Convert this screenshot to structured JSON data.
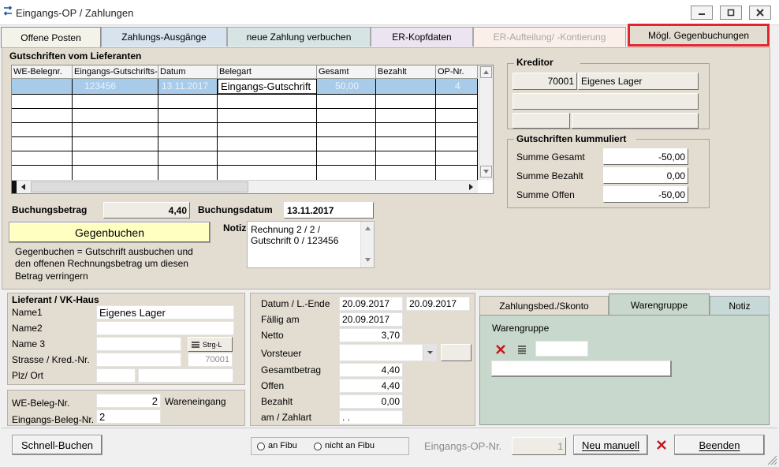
{
  "window": {
    "title": "Eingangs-OP / Zahlungen"
  },
  "tabs": [
    {
      "label": "Offene Posten"
    },
    {
      "label": "Zahlungs-Ausgänge"
    },
    {
      "label": "neue Zahlung verbuchen"
    },
    {
      "label": "ER-Kopfdaten"
    },
    {
      "label": "ER-Aufteilung/ -Kontierung"
    },
    {
      "label": "Mögl. Gegenbuchungen"
    }
  ],
  "gutschriften": {
    "title": "Gutschriften vom Lieferanten",
    "columns": [
      "WE-Belegnr.",
      "Eingangs-Gutschrifts-",
      "Datum",
      "Belegart",
      "Gesamt",
      "Bezahlt",
      "OP-Nr."
    ],
    "rows": [
      {
        "we": "",
        "nr": "123456",
        "datum": "13.11.2017",
        "belegart": "Eingangs-Gutschrift",
        "gesamt": "50,00",
        "bezahlt": "",
        "op": "4"
      }
    ]
  },
  "kreditor": {
    "title": "Kreditor",
    "nr": "70001",
    "name": "Eigenes Lager"
  },
  "kummuliert": {
    "title": "Gutschriften kummuliert",
    "summe_gesamt_label": "Summe Gesamt",
    "summe_gesamt": "-50,00",
    "summe_bezahlt_label": "Summe Bezahlt",
    "summe_bezahlt": "0,00",
    "summe_offen_label": "Summe Offen",
    "summe_offen": "-50,00"
  },
  "buchung": {
    "betrag_label": "Buchungsbetrag",
    "betrag": "4,40",
    "datum_label": "Buchungsdatum",
    "datum": "13.11.2017",
    "gegenbuchen_label": "Gegenbuchen",
    "hint_1": "Gegenbuchen = Gutschrift ausbuchen und",
    "hint_2": "den offenen Rechnungsbetrag um diesen",
    "hint_3": "Betrag verringern",
    "notiz_label": "Notiz",
    "notiz_1": "Rechnung 2 / 2 /",
    "notiz_2": "Gutschrift 0 / 123456"
  },
  "lieferant": {
    "title": "Lieferant / VK-Haus",
    "name1_label": "Name1",
    "name1": "Eigenes Lager",
    "name2_label": "Name2",
    "name3_label": "Name 3",
    "strg_label": "Strg-L",
    "strasse_label": "Strasse / Kred.-Nr.",
    "kred_nr": "70001",
    "plz_label": "Plz/ Ort"
  },
  "beleg": {
    "we_label": "WE-Beleg-Nr.",
    "we_value": "2",
    "we_text": "Wareneingang",
    "eingang_label": "Eingangs-Beleg-Nr.",
    "eingang_value": "2"
  },
  "rechnung": {
    "datum_label": "Datum / L.-Ende",
    "datum": "20.09.2017",
    "l_ende": "20.09.2017",
    "faellig_label": "Fällig am",
    "faellig": "20.09.2017",
    "netto_label": "Netto",
    "netto": "3,70",
    "vorsteuer_label": "Vorsteuer",
    "gesamt_label": "Gesamtbetrag",
    "gesamt": "4,40",
    "offen_label": "Offen",
    "offen": "4,40",
    "bezahlt_label": "Bezahlt",
    "bezahlt": "0,00",
    "zahlart_label": "am / Zahlart",
    "zahlart": ". ."
  },
  "subtabs": [
    {
      "label": "Zahlungsbed./Skonto"
    },
    {
      "label": "Warengruppe"
    },
    {
      "label": "Notiz"
    }
  ],
  "warengruppe": {
    "label": "Warengruppe"
  },
  "footer": {
    "schnell_label": "Schnell-Buchen",
    "an_fibu": "an Fibu",
    "nicht_an_fibu": "nicht an Fibu",
    "op_nr_label": "Eingangs-OP-Nr.",
    "op_nr": "1",
    "neu_manuell": "Neu manuell",
    "beenden": "Beenden"
  },
  "colors": {
    "highlight": "#e0262c",
    "gegenbuchen_bg": "#ffffc1",
    "panel": "#e2dcd1",
    "selected_row": "#a9cbea"
  }
}
